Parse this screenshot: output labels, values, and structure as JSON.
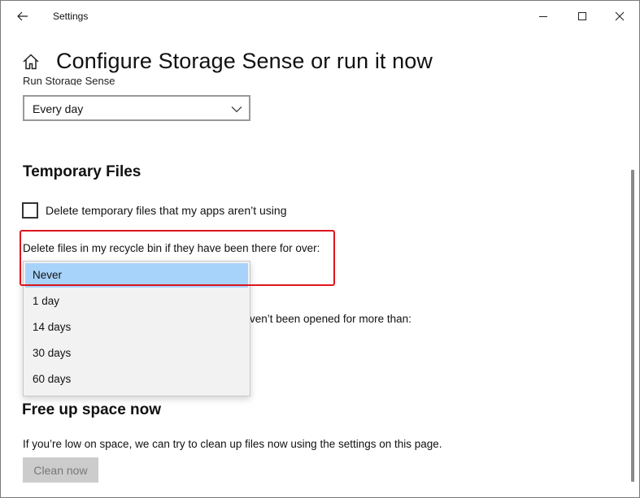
{
  "window": {
    "title": "Settings"
  },
  "header": {
    "page_title": "Configure Storage Sense or run it now"
  },
  "run_storage_sense": {
    "label": "Run Storage Sense",
    "selected_value": "Every day"
  },
  "temporary_files": {
    "heading": "Temporary Files",
    "checkbox_label": "Delete temporary files that my apps aren’t using",
    "checkbox_checked": false,
    "recycle_bin_label": "Delete files in my recycle bin if they have been there for over:",
    "downloads_label_partial": "ven’t been opened for more than:"
  },
  "recycle_dropdown": {
    "options": [
      "Never",
      "1 day",
      "14 days",
      "30 days",
      "60 days"
    ],
    "selected": "Never"
  },
  "free_up_space": {
    "heading": "Free up space now",
    "description": "If you’re low on space, we can try to clean up files now using the settings on this page.",
    "button_label": "Clean now"
  },
  "colors": {
    "highlight": "#e0141e",
    "selected_option": "#a7d3fb",
    "disabled_button": "#cccccc"
  },
  "icons": [
    "back-arrow-icon",
    "minimize-icon",
    "maximize-icon",
    "close-icon",
    "home-icon",
    "chevron-down-icon"
  ]
}
